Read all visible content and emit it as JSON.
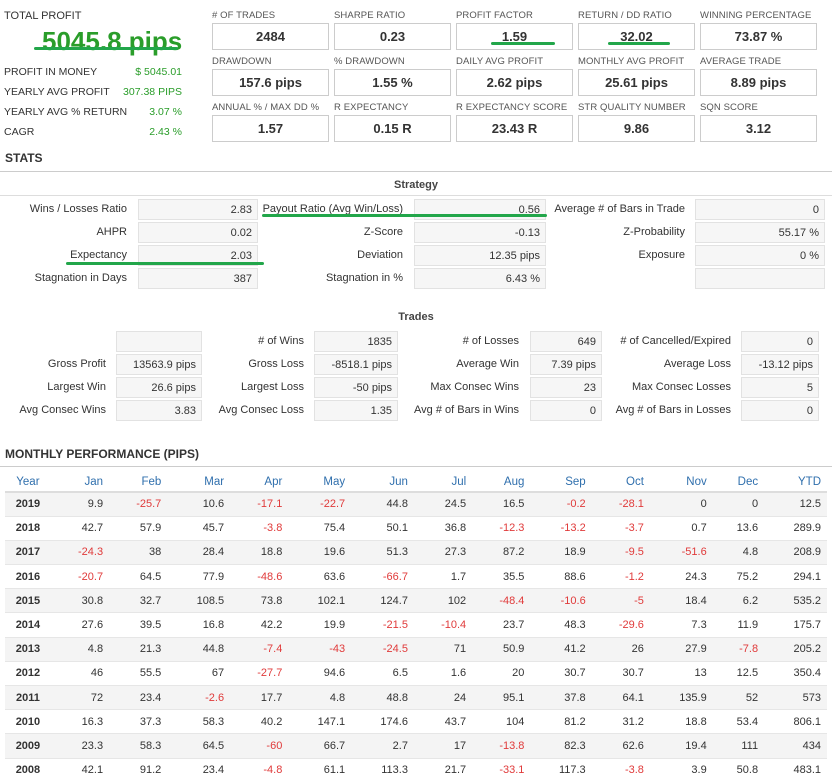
{
  "total": {
    "label": "TOTAL PROFIT",
    "value": "5045.8 pips",
    "rows": [
      {
        "label": "PROFIT IN MONEY",
        "value": "$ 5045.01"
      },
      {
        "label": "YEARLY AVG PROFIT",
        "value": "307.38 PIPS"
      },
      {
        "label": "YEARLY AVG % RETURN",
        "value": "3.07 %"
      },
      {
        "label": "CAGR",
        "value": "2.43 %"
      }
    ]
  },
  "metrics": [
    {
      "label": "# OF TRADES",
      "value": "2484"
    },
    {
      "label": "SHARPE RATIO",
      "value": "0.23"
    },
    {
      "label": "PROFIT FACTOR",
      "value": "1.59"
    },
    {
      "label": "RETURN / DD RATIO",
      "value": "32.02"
    },
    {
      "label": "WINNING PERCENTAGE",
      "value": "73.87 %"
    },
    {
      "label": "DRAWDOWN",
      "value": "157.6 pips"
    },
    {
      "label": "% DRAWDOWN",
      "value": "1.55 %"
    },
    {
      "label": "DAILY AVG PROFIT",
      "value": "2.62 pips"
    },
    {
      "label": "MONTHLY AVG PROFIT",
      "value": "25.61 pips"
    },
    {
      "label": "AVERAGE TRADE",
      "value": "8.89 pips"
    },
    {
      "label": "ANNUAL % / MAX DD %",
      "value": "1.57"
    },
    {
      "label": "R EXPECTANCY",
      "value": "0.15 R"
    },
    {
      "label": "R EXPECTANCY SCORE",
      "value": "23.43 R"
    },
    {
      "label": "STR QUALITY NUMBER",
      "value": "9.86"
    },
    {
      "label": "SQN SCORE",
      "value": "3.12"
    }
  ],
  "stats_title": "STATS",
  "strategy": {
    "title": "Strategy",
    "items": [
      {
        "label": "Wins / Losses Ratio",
        "value": "2.83"
      },
      {
        "label": "Payout Ratio (Avg Win/Loss)",
        "value": "0.56"
      },
      {
        "label": "Average # of Bars in Trade",
        "value": "0"
      },
      {
        "label": "AHPR",
        "value": "0.02"
      },
      {
        "label": "Z-Score",
        "value": "-0.13"
      },
      {
        "label": "Z-Probability",
        "value": "55.17 %"
      },
      {
        "label": "Expectancy",
        "value": "2.03"
      },
      {
        "label": "Deviation",
        "value": "12.35 pips"
      },
      {
        "label": "Exposure",
        "value": "0 %"
      },
      {
        "label": "Stagnation in Days",
        "value": "387"
      },
      {
        "label": "Stagnation in %",
        "value": "6.43 %"
      },
      {
        "label": "",
        "value": ""
      }
    ]
  },
  "trades": {
    "title": "Trades",
    "items": [
      {
        "label": "",
        "value": ""
      },
      {
        "label": "# of Wins",
        "value": "1835"
      },
      {
        "label": "# of Losses",
        "value": "649"
      },
      {
        "label": "# of Cancelled/Expired",
        "value": "0"
      },
      {
        "label": "Gross Profit",
        "value": "13563.9 pips"
      },
      {
        "label": "Gross Loss",
        "value": "-8518.1 pips"
      },
      {
        "label": "Average Win",
        "value": "7.39 pips"
      },
      {
        "label": "Average Loss",
        "value": "-13.12 pips"
      },
      {
        "label": "Largest Win",
        "value": "26.6 pips"
      },
      {
        "label": "Largest Loss",
        "value": "-50 pips"
      },
      {
        "label": "Max Consec Wins",
        "value": "23"
      },
      {
        "label": "Max Consec Losses",
        "value": "5"
      },
      {
        "label": "Avg Consec Wins",
        "value": "3.83"
      },
      {
        "label": "Avg Consec Loss",
        "value": "1.35"
      },
      {
        "label": "Avg # of Bars in Wins",
        "value": "0"
      },
      {
        "label": "Avg # of Bars in Losses",
        "value": "0"
      }
    ]
  },
  "monthly": {
    "title": "MONTHLY PERFORMANCE (PIPS)",
    "headers": [
      "Year",
      "Jan",
      "Feb",
      "Mar",
      "Apr",
      "May",
      "Jun",
      "Jul",
      "Aug",
      "Sep",
      "Oct",
      "Nov",
      "Dec",
      "YTD"
    ],
    "rows": [
      [
        "2019",
        "9.9",
        "-25.7",
        "10.6",
        "-17.1",
        "-22.7",
        "44.8",
        "24.5",
        "16.5",
        "-0.2",
        "-28.1",
        "0",
        "0",
        "12.5"
      ],
      [
        "2018",
        "42.7",
        "57.9",
        "45.7",
        "-3.8",
        "75.4",
        "50.1",
        "36.8",
        "-12.3",
        "-13.2",
        "-3.7",
        "0.7",
        "13.6",
        "289.9"
      ],
      [
        "2017",
        "-24.3",
        "38",
        "28.4",
        "18.8",
        "19.6",
        "51.3",
        "27.3",
        "87.2",
        "18.9",
        "-9.5",
        "-51.6",
        "4.8",
        "208.9"
      ],
      [
        "2016",
        "-20.7",
        "64.5",
        "77.9",
        "-48.6",
        "63.6",
        "-66.7",
        "1.7",
        "35.5",
        "88.6",
        "-1.2",
        "24.3",
        "75.2",
        "294.1"
      ],
      [
        "2015",
        "30.8",
        "32.7",
        "108.5",
        "73.8",
        "102.1",
        "124.7",
        "102",
        "-48.4",
        "-10.6",
        "-5",
        "18.4",
        "6.2",
        "535.2"
      ],
      [
        "2014",
        "27.6",
        "39.5",
        "16.8",
        "42.2",
        "19.9",
        "-21.5",
        "-10.4",
        "23.7",
        "48.3",
        "-29.6",
        "7.3",
        "11.9",
        "175.7"
      ],
      [
        "2013",
        "4.8",
        "21.3",
        "44.8",
        "-7.4",
        "-43",
        "-24.5",
        "71",
        "50.9",
        "41.2",
        "26",
        "27.9",
        "-7.8",
        "205.2"
      ],
      [
        "2012",
        "46",
        "55.5",
        "67",
        "-27.7",
        "94.6",
        "6.5",
        "1.6",
        "20",
        "30.7",
        "30.7",
        "13",
        "12.5",
        "350.4"
      ],
      [
        "2011",
        "72",
        "23.4",
        "-2.6",
        "17.7",
        "4.8",
        "48.8",
        "24",
        "95.1",
        "37.8",
        "64.1",
        "135.9",
        "52",
        "573"
      ],
      [
        "2010",
        "16.3",
        "37.3",
        "58.3",
        "40.2",
        "147.1",
        "174.6",
        "43.7",
        "104",
        "81.2",
        "31.2",
        "18.8",
        "53.4",
        "806.1"
      ],
      [
        "2009",
        "23.3",
        "58.3",
        "64.5",
        "-60",
        "66.7",
        "2.7",
        "17",
        "-13.8",
        "82.3",
        "62.6",
        "19.4",
        "111",
        "434"
      ],
      [
        "2008",
        "42.1",
        "91.2",
        "23.4",
        "-4.8",
        "61.1",
        "113.3",
        "21.7",
        "-33.1",
        "117.3",
        "-3.8",
        "3.9",
        "50.8",
        "483.1"
      ]
    ]
  },
  "colors": {
    "positive": "#2a9d2a",
    "negative": "#e03a3a",
    "header_link": "#2f6fad",
    "highlight": "#22a64a"
  }
}
